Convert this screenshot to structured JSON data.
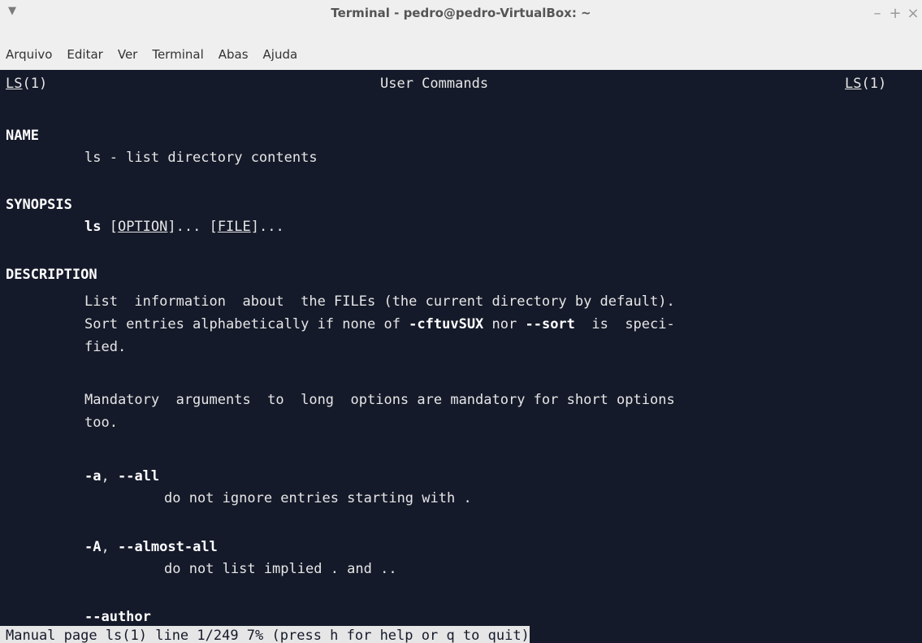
{
  "window": {
    "title": "Terminal - pedro@pedro-VirtualBox: ~",
    "controls": {
      "minimize": "–",
      "maximize": "+",
      "close": "×"
    }
  },
  "menubar": {
    "items": [
      "Arquivo",
      "Editar",
      "Ver",
      "Terminal",
      "Abas",
      "Ajuda"
    ]
  },
  "man": {
    "header_left": "LS",
    "header_left_suffix": "(1)",
    "header_center": "User Commands",
    "header_right": "LS",
    "header_right_suffix": "(1)",
    "name_heading": "NAME",
    "name_text": "ls - list directory contents",
    "synopsis_heading": "SYNOPSIS",
    "synopsis_cmd": "ls",
    "synopsis_sp1": " [",
    "synopsis_option": "OPTION",
    "synopsis_mid": "]... [",
    "synopsis_file": "FILE",
    "synopsis_end": "]...",
    "description_heading": "DESCRIPTION",
    "desc_line1": "List  information  about  the FILEs (the current directory by default).",
    "desc_line2_a": "Sort entries alphabetically if none of ",
    "desc_line2_b": "-cftuvSUX",
    "desc_line2_c": " nor ",
    "desc_line2_d": "--sort",
    "desc_line2_e": "  is  speci-",
    "desc_line3": "fied.",
    "mandatory_line1": "Mandatory  arguments  to  long  options are mandatory for short options",
    "mandatory_line2": "too.",
    "opt_a_short": "-a",
    "opt_a_sep": ", ",
    "opt_a_long": "--all",
    "opt_a_desc": "do not ignore entries starting with .",
    "opt_A_short": "-A",
    "opt_A_sep": ", ",
    "opt_A_long": "--almost-all",
    "opt_A_desc": "do not list implied . and ..",
    "opt_author": "--author"
  },
  "status": {
    "text": "Manual page ls(1) line 1/249 7% (press h for help or q to quit)"
  }
}
